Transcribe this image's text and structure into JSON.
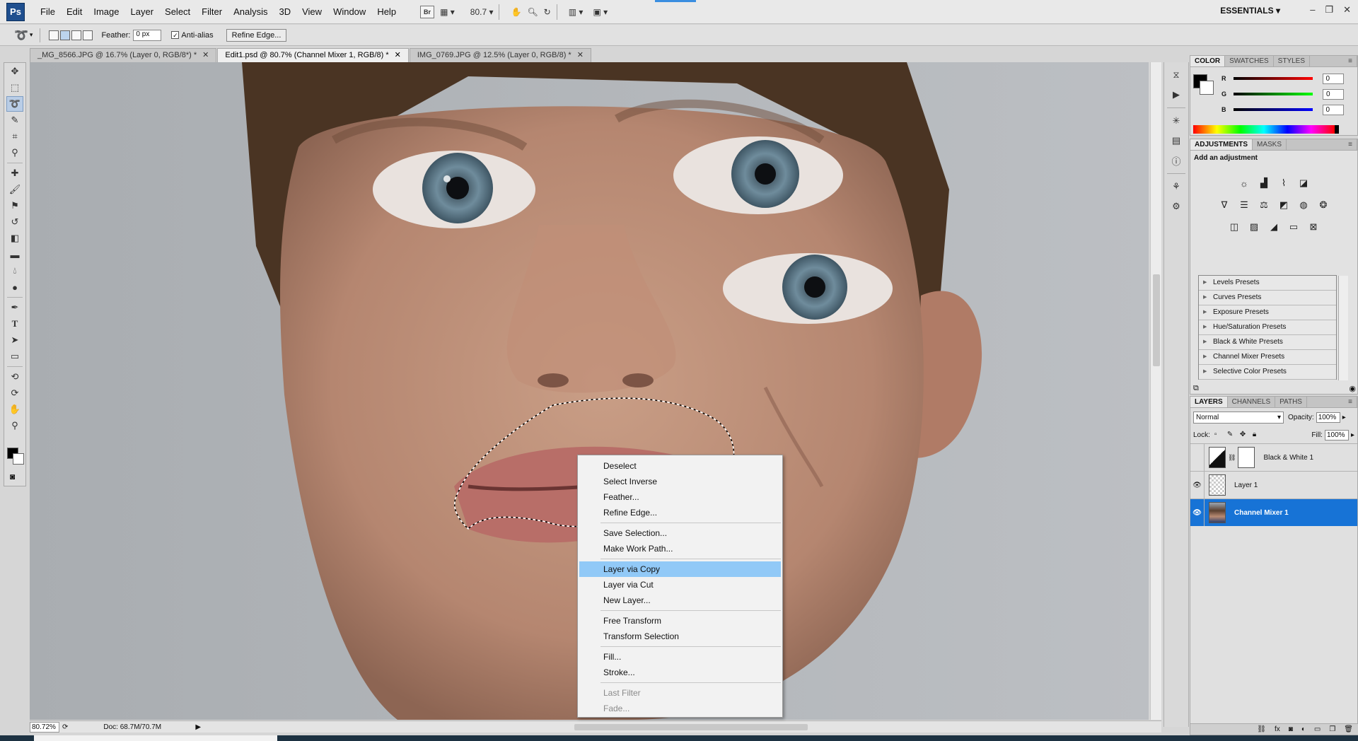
{
  "menubar": {
    "logo": "Ps",
    "items": [
      "File",
      "Edit",
      "Image",
      "Layer",
      "Select",
      "Filter",
      "Analysis",
      "3D",
      "View",
      "Window",
      "Help"
    ],
    "bridge": "Br",
    "zoom": "80.7",
    "workspace": "ESSENTIALS"
  },
  "options": {
    "feather_label": "Feather:",
    "feather_value": "0 px",
    "antialias_label": "Anti-alias",
    "refine_label": "Refine Edge..."
  },
  "tabs": [
    {
      "label": "_MG_8566.JPG @ 16.7% (Layer 0, RGB/8*) *"
    },
    {
      "label": "Edit1.psd @ 80.7% (Channel Mixer 1, RGB/8) *"
    },
    {
      "label": "IMG_0769.JPG @ 12.5% (Layer 0, RGB/8) *"
    }
  ],
  "status": {
    "zoom": "80.72%",
    "doc": "Doc: 68.7M/70.7M"
  },
  "context_menu": {
    "items": [
      {
        "label": "Deselect"
      },
      {
        "label": "Select Inverse"
      },
      {
        "label": "Feather..."
      },
      {
        "label": "Refine Edge..."
      },
      {
        "label": "Save Selection..."
      },
      {
        "label": "Make Work Path..."
      },
      {
        "label": "Layer via Copy"
      },
      {
        "label": "Layer via Cut"
      },
      {
        "label": "New Layer..."
      },
      {
        "label": "Free Transform"
      },
      {
        "label": "Transform Selection"
      },
      {
        "label": "Fill..."
      },
      {
        "label": "Stroke..."
      },
      {
        "label": "Last Filter"
      },
      {
        "label": "Fade..."
      }
    ]
  },
  "color_panel": {
    "tabs": [
      "COLOR",
      "SWATCHES",
      "STYLES"
    ],
    "r_label": "R",
    "g_label": "G",
    "b_label": "B",
    "r": "0",
    "g": "0",
    "b": "0"
  },
  "adjustments": {
    "tabs": [
      "ADJUSTMENTS",
      "MASKS"
    ],
    "title": "Add an adjustment",
    "presets": [
      "Levels Presets",
      "Curves Presets",
      "Exposure Presets",
      "Hue/Saturation Presets",
      "Black & White Presets",
      "Channel Mixer Presets",
      "Selective Color Presets"
    ]
  },
  "layers": {
    "tabs": [
      "LAYERS",
      "CHANNELS",
      "PATHS"
    ],
    "blend_mode": "Normal",
    "opacity_label": "Opacity:",
    "opacity": "100%",
    "lock_label": "Lock:",
    "fill_label": "Fill:",
    "fill": "100%",
    "items": [
      {
        "name": "Black & White 1"
      },
      {
        "name": "Layer 1"
      },
      {
        "name": "Channel Mixer 1"
      }
    ]
  },
  "colors": {
    "selection_highlight": "#1773d6",
    "menu_highlight": "#91c9f7"
  }
}
